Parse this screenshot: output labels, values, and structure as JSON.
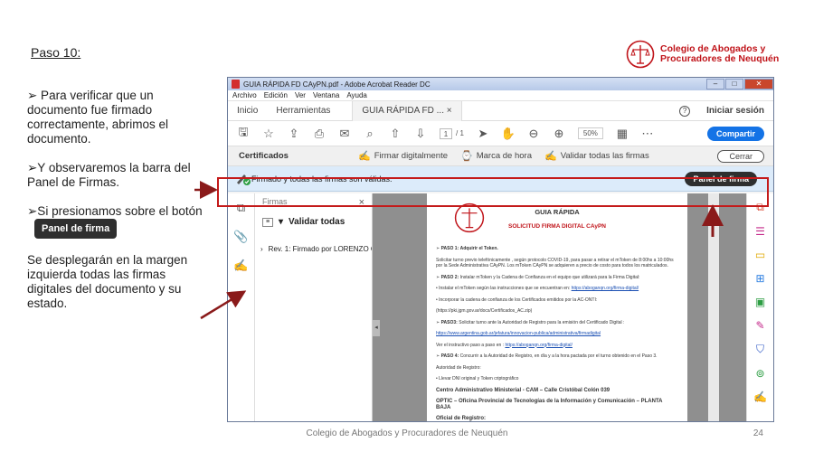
{
  "slide": {
    "title": "Paso 10:",
    "bullet1": "➢ Para verificar que un documento fue firmado correctamente, abrimos el documento.",
    "bullet2": "➢Y observaremos la barra del Panel de Firmas.",
    "bullet3_text": "➢Si presionamos sobre el botón",
    "bullet3_badge": "Panel de firma",
    "bullet4": "Se desplegarán en la margen izquierda todas las firmas digitales del documento y su estado.",
    "footer": "Colegio de Abogados y Procuradores de Neuquén",
    "page_number": "24",
    "logo_line1": "Colegio de Abogados y",
    "logo_line2": "Procuradores de Neuquén"
  },
  "window": {
    "title": "GUIA RÁPIDA FD CAyPN.pdf - Adobe Acrobat Reader DC",
    "menu": [
      "Archivo",
      "Edición",
      "Ver",
      "Ventana",
      "Ayuda"
    ],
    "tabs": {
      "home": "Inicio",
      "tools": "Herramientas",
      "doc": "GUIA RÁPIDA FD ...",
      "doc_close": "×"
    },
    "help": "?",
    "signin": "Iniciar sesión",
    "toolbar": {
      "page_current": "1",
      "page_total": "/ 1",
      "zoom": "50%",
      "share": "Compartir"
    },
    "certbar": {
      "label": "Certificados",
      "sign": "Firmar digitalmente",
      "timestamp": "Marca de hora",
      "validate": "Validar todas las firmas",
      "close": "Cerrar"
    },
    "sigbar": {
      "message": "Firmado y todas las firmas son válidas.",
      "panel_button": "Panel de firma"
    },
    "sigpanel": {
      "title": "Firmas",
      "close": "×",
      "validate_all": "Validar todas",
      "revision": "Rev. 1: Firmado por LORENZO O"
    }
  },
  "document": {
    "title": "GUIA RÁPIDA",
    "subtitle": "SOLICITUD FIRMA DIGITAL CAyPN",
    "p1_label": "PASO 1:",
    "p1": "Adquirir el Token.",
    "p1_body": "Solicitar turno previo telefónicamente , según protocolo COVID-19, para pasar a retirar el mToken de 8:00hs a 10:00hs por la Sede Administrativa CAyPN. Los mToken CAyPN se adquieren a precio de costo para todos los matriculados.",
    "p2_label": "PASO 2:",
    "p2": "Instalar mToken y la Cadena de Confianza en el equipo que utilizará para la Firma Digital:",
    "p2_a": "Instalar el mToken según las instrucciones que se encuentran en:",
    "p2_a_link": "https://aboganqn.org/firma-digital/",
    "p2_b": "Incorporar la cadena de confianza de los Certificados emitidos por la AC-ONTI:",
    "p2_b_link": "(https://pki.jgm.gov.ar/docs/Certificados_AC.zip)",
    "p3_label": "PASO3:",
    "p3": "Solicitar turno ante la Autoridad de Registro para la emisión del Certificado Digital :",
    "p3_link": "https://www.argentina.gob.ar/jefatura/innovacion-publica/administrativa/firmadigital",
    "p3_b": "Ver el instructivo paso a paso en :",
    "p3_b_link": "https://aboganqn.org/firma-digital/",
    "p4_label": "PASO 4:",
    "p4": "Concurrir a la Autoridad de Registro, en día y a la hora pactada por el turno obtenido en el Paso 3.",
    "p4_b": "Autoridad de Registro:",
    "p4_c": "Llevar DNI original y Token criptográfico",
    "center": "Centro Administrativo Ministerial - CAM – Calle Cristóbal Colón 039",
    "optic": "OPTIC – Oficina Provincial de Tecnologías de la Información y Comunicación – PLANTA BAJA",
    "oficial": "Oficial de Registro:"
  },
  "colors": {
    "annotation": "#c41a1a",
    "accent": "#1473e6",
    "logo": "#c0141a",
    "sigbar": "#dcebfa"
  }
}
